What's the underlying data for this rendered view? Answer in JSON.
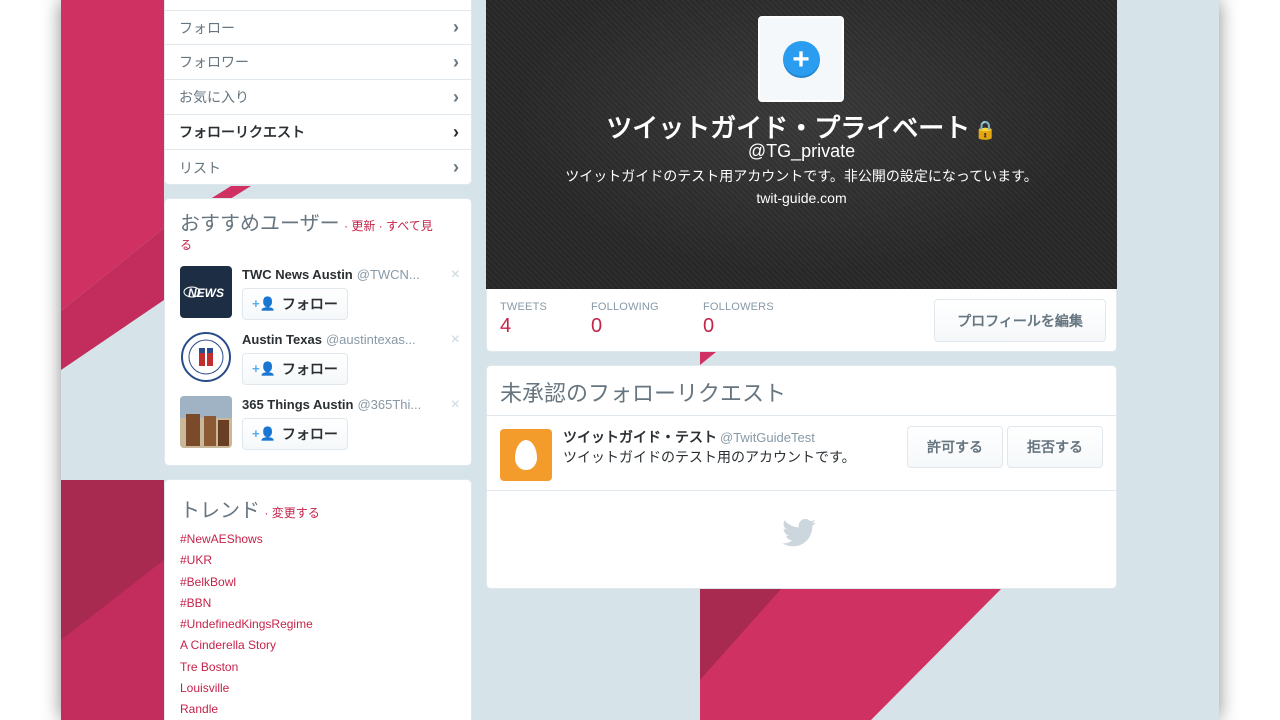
{
  "nav": {
    "items": [
      {
        "label": "フォロー",
        "active": false
      },
      {
        "label": "フォロワー",
        "active": false
      },
      {
        "label": "お気に入り",
        "active": false
      },
      {
        "label": "フォローリクエスト",
        "active": true
      },
      {
        "label": "リスト",
        "active": false
      }
    ],
    "chevron": "›"
  },
  "who_to_follow": {
    "title": "おすすめユーザー",
    "links_line1": "· 更新 · すべて見",
    "links_line2": "る",
    "follow_label": "フォロー",
    "users": [
      {
        "name": "TWC News Austin",
        "handle": "@TWCN...",
        "avatar_icon": "twc-news-logo"
      },
      {
        "name": "Austin Texas",
        "handle": "@austintexas...",
        "avatar_icon": "city-of-austin-seal"
      },
      {
        "name": "365 Things Austin",
        "handle": "@365Thi...",
        "avatar_icon": "boots-photo"
      }
    ],
    "dismiss": "×"
  },
  "trends": {
    "title": "トレンド",
    "change": "· 変更する",
    "items": [
      "#NewAEShows",
      "#UKR",
      "#BelkBowl",
      "#BBN",
      "#UndefinedKingsRegime",
      "A Cinderella Story",
      "Tre Boston",
      "Louisville",
      "Randle"
    ]
  },
  "profile": {
    "name": "ツイットガイド・プライベート",
    "lock": "🔒",
    "handle": "@TG_private",
    "bio": "ツイットガイドのテスト用アカウントです。非公開の設定になっています。",
    "url": "twit-guide.com",
    "add_photo_icon": "plus",
    "plus": "+"
  },
  "stats": {
    "tweets_label": "TWEETS",
    "tweets": "4",
    "following_label": "FOLLOWING",
    "following": "0",
    "followers_label": "FOLLOWERS",
    "followers": "0",
    "edit_label": "プロフィールを編集"
  },
  "pending": {
    "title": "未承認のフォローリクエスト",
    "request": {
      "name": "ツイットガイド・テスト",
      "handle": "@TwitGuideTest",
      "bio": "ツイットガイドのテスト用のアカウントです。"
    },
    "allow_label": "許可する",
    "deny_label": "拒否する"
  },
  "colors": {
    "accent": "#c5234a",
    "pink": "#d03163",
    "pink_dark": "#a82a50",
    "bg": "#d6e4ea"
  }
}
